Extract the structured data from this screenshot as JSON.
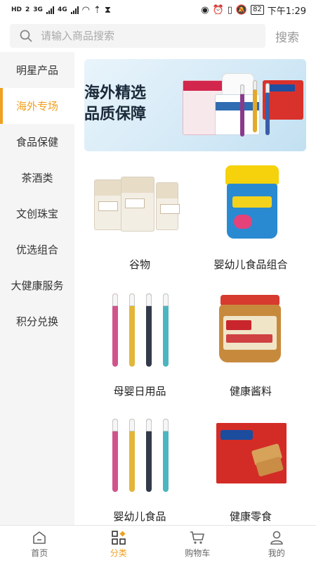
{
  "status_bar": {
    "left": [
      "HD",
      "2",
      "3G",
      "4G"
    ],
    "battery": "82",
    "time": "下午1:29"
  },
  "search": {
    "placeholder": "请输入商品搜索",
    "button_label": "搜索"
  },
  "sidebar": {
    "items": [
      {
        "label": "明星产品",
        "active": false
      },
      {
        "label": "海外专场",
        "active": true
      },
      {
        "label": "食品保健",
        "active": false
      },
      {
        "label": "茶酒类",
        "active": false
      },
      {
        "label": "文创珠宝",
        "active": false
      },
      {
        "label": "优选组合",
        "active": false
      },
      {
        "label": "大健康服务",
        "active": false
      },
      {
        "label": "积分兑换",
        "active": false
      }
    ]
  },
  "banner": {
    "line1": "海外精选",
    "line2": "品质保障"
  },
  "categories": [
    {
      "label": "谷物",
      "icon": "cereal-bags-image"
    },
    {
      "label": "婴幼儿食品组合",
      "icon": "gummies-jar-image"
    },
    {
      "label": "母婴日用品",
      "icon": "toothbrush-image"
    },
    {
      "label": "健康酱料",
      "icon": "peanut-butter-image"
    },
    {
      "label": "婴幼儿食品",
      "icon": "toothbrush-image"
    },
    {
      "label": "健康零食",
      "icon": "biscuit-box-image"
    }
  ],
  "bottom_nav": [
    {
      "label": "首页",
      "icon": "home-icon",
      "active": false
    },
    {
      "label": "分类",
      "icon": "category-icon",
      "active": true
    },
    {
      "label": "购物车",
      "icon": "cart-icon",
      "active": false
    },
    {
      "label": "我的",
      "icon": "user-icon",
      "active": false
    }
  ],
  "colors": {
    "accent": "#f0a020",
    "sidebar_bg": "#f5f5f5"
  }
}
